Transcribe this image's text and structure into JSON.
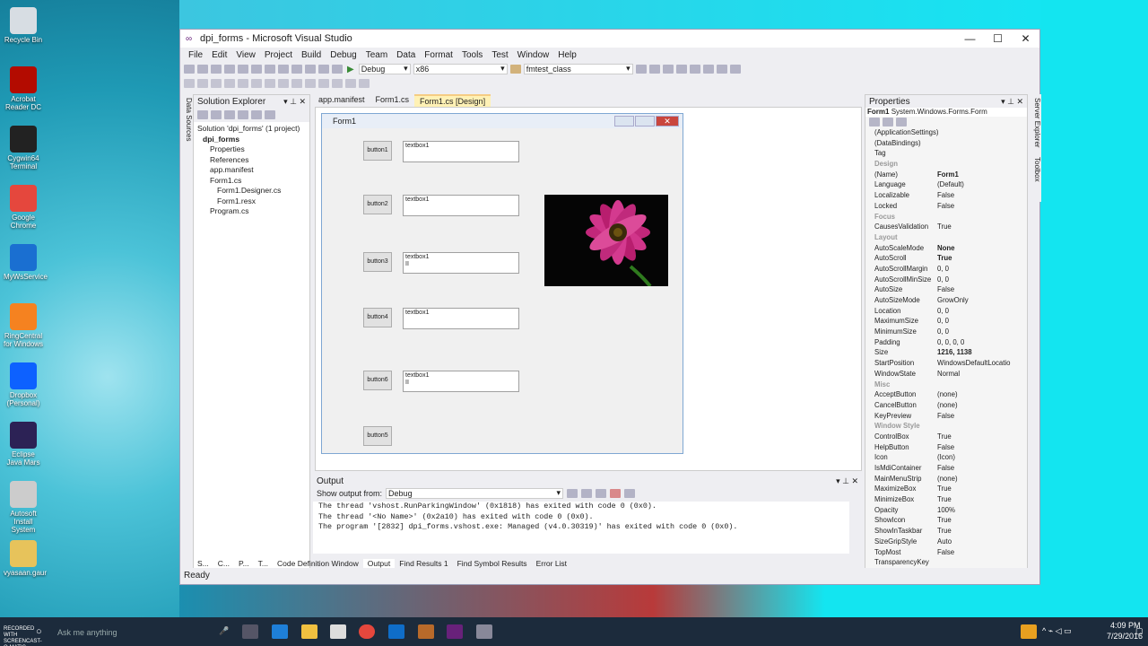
{
  "desktop_icons": [
    {
      "label": "Recycle Bin",
      "color": "#d7dde3"
    },
    {
      "label": "Acrobat Reader DC",
      "color": "#b30b00"
    },
    {
      "label": "Cygwin64 Terminal",
      "color": "#222"
    },
    {
      "label": "Google Chrome",
      "color": "#e5473d"
    },
    {
      "label": "MyWsService",
      "color": "#1a6fd1"
    },
    {
      "label": "RingCentral for Windows",
      "color": "#f58220"
    },
    {
      "label": "Dropbox (Personal)",
      "color": "#0d61ff"
    },
    {
      "label": "Eclipse Java Mars",
      "color": "#2c2255"
    },
    {
      "label": "Autosoft Install System",
      "color": "#ccc"
    },
    {
      "label": "vyasaan.gaur",
      "color": "#e7c35b"
    }
  ],
  "window": {
    "title": "dpi_forms - Microsoft Visual Studio",
    "min": "—",
    "max": "☐",
    "close": "✕"
  },
  "menu": [
    "File",
    "Edit",
    "View",
    "Project",
    "Build",
    "Debug",
    "Team",
    "Data",
    "Format",
    "Tools",
    "Test",
    "Window",
    "Help"
  ],
  "toolbar": {
    "config": "Debug",
    "platform": "x86",
    "class": "fmtest_class"
  },
  "solution_explorer": {
    "title": "Solution Explorer",
    "side_label": "Data Sources",
    "items": [
      "Solution 'dpi_forms' (1 project)",
      "dpi_forms",
      "Properties",
      "References",
      "app.manifest",
      "Form1.cs",
      "Form1.Designer.cs",
      "Form1.resx",
      "Program.cs"
    ]
  },
  "doc_tabs": [
    "app.manifest",
    "Form1.cs",
    "Form1.cs [Design]"
  ],
  "form": {
    "title": "Form1",
    "buttons": [
      "button1",
      "button2",
      "button3",
      "button4",
      "button6",
      "button5"
    ],
    "textboxes": [
      {
        "line1": "textbox1",
        "line2": ""
      },
      {
        "line1": "textbox1",
        "line2": ""
      },
      {
        "line1": "textbox1",
        "line2": "II"
      },
      {
        "line1": "textbox1",
        "line2": ""
      },
      {
        "line1": "textbox1",
        "line2": "II"
      }
    ]
  },
  "output": {
    "title": "Output",
    "show_from_label": "Show output from:",
    "show_from_value": "Debug",
    "lines": [
      "The thread 'vshost.RunParkingWindow' (0x1818) has exited with code 0 (0x0).",
      "The thread '<No Name>' (0x2a10) has exited with code 0 (0x0).",
      "The program '[2832] dpi_forms.vshost.exe: Managed (v4.0.30319)' has exited with code 0 (0x0)."
    ]
  },
  "bottom_tabs": [
    "S...",
    "C...",
    "P...",
    "T...",
    "Code Definition Window",
    "Output",
    "Find Results 1",
    "Find Symbol Results",
    "Error List"
  ],
  "properties": {
    "title": "Properties",
    "object": "Form1",
    "object_type": "System.Windows.Forms.Form",
    "side_labels": [
      "Server Explorer",
      "Toolbox"
    ],
    "rows": [
      {
        "n": "(ApplicationSettings)",
        "v": ""
      },
      {
        "n": "(DataBindings)",
        "v": ""
      },
      {
        "n": "Tag",
        "v": ""
      },
      {
        "cat": "Design"
      },
      {
        "n": "(Name)",
        "v": "Form1",
        "b": true
      },
      {
        "n": "Language",
        "v": "(Default)"
      },
      {
        "n": "Localizable",
        "v": "False"
      },
      {
        "n": "Locked",
        "v": "False"
      },
      {
        "cat": "Focus"
      },
      {
        "n": "CausesValidation",
        "v": "True"
      },
      {
        "cat": "Layout"
      },
      {
        "n": "AutoScaleMode",
        "v": "None",
        "b": true
      },
      {
        "n": "AutoScroll",
        "v": "True",
        "b": true
      },
      {
        "n": "AutoScrollMargin",
        "v": "0, 0"
      },
      {
        "n": "AutoScrollMinSize",
        "v": "0, 0"
      },
      {
        "n": "AutoSize",
        "v": "False"
      },
      {
        "n": "AutoSizeMode",
        "v": "GrowOnly"
      },
      {
        "n": "Location",
        "v": "0, 0"
      },
      {
        "n": "MaximumSize",
        "v": "0, 0"
      },
      {
        "n": "MinimumSize",
        "v": "0, 0"
      },
      {
        "n": "Padding",
        "v": "0, 0, 0, 0"
      },
      {
        "n": "Size",
        "v": "1216, 1138",
        "b": true
      },
      {
        "n": "StartPosition",
        "v": "WindowsDefaultLocatio"
      },
      {
        "n": "WindowState",
        "v": "Normal"
      },
      {
        "cat": "Misc"
      },
      {
        "n": "AcceptButton",
        "v": "(none)"
      },
      {
        "n": "CancelButton",
        "v": "(none)"
      },
      {
        "n": "KeyPreview",
        "v": "False"
      },
      {
        "cat": "Window Style"
      },
      {
        "n": "ControlBox",
        "v": "True"
      },
      {
        "n": "HelpButton",
        "v": "False"
      },
      {
        "n": "Icon",
        "v": "(Icon)"
      },
      {
        "n": "IsMdiContainer",
        "v": "False"
      },
      {
        "n": "MainMenuStrip",
        "v": "(none)"
      },
      {
        "n": "MaximizeBox",
        "v": "True"
      },
      {
        "n": "MinimizeBox",
        "v": "True"
      },
      {
        "n": "Opacity",
        "v": "100%"
      },
      {
        "n": "ShowIcon",
        "v": "True"
      },
      {
        "n": "ShowInTaskbar",
        "v": "True"
      },
      {
        "n": "SizeGripStyle",
        "v": "Auto"
      },
      {
        "n": "TopMost",
        "v": "False"
      },
      {
        "n": "TransparencyKey",
        "v": ""
      }
    ]
  },
  "status": "Ready",
  "taskbar": {
    "search_placeholder": "Ask me anything",
    "time": "4:09 PM",
    "date": "7/29/2016",
    "watermark": "RECORDED WITH SCREENCAST-O-MATIC"
  }
}
